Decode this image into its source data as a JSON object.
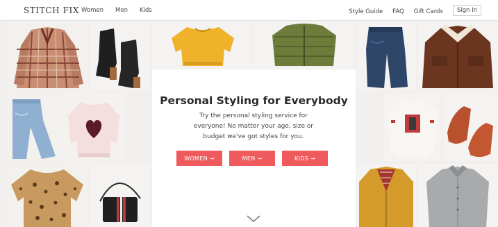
{
  "header": {
    "logo": "STITCH FIX",
    "nav_left": [
      "Women",
      "Men",
      "Kids"
    ],
    "nav_right": [
      "Style Guide",
      "FAQ",
      "Gift Cards"
    ],
    "sign_in": "Sign In"
  },
  "hero": {
    "title": "Personal Styling for Everybody",
    "subtitle": "Try the personal styling service for everyone! No matter your age, size or budget we've got styles for you.",
    "buttons": [
      "WOMEN →",
      "MEN →",
      "KIDS →"
    ],
    "accent_color": "#ef5a5d"
  },
  "tiles": [
    "plaid-coat",
    "black-boots",
    "yellow-sweater",
    "green-puffer-jacket",
    "dark-jeans",
    "brown-corduroy-jacket",
    "light-jeans",
    "heart-sweater",
    "graphic-tee",
    "brown-sneakers",
    "leopard-blouse",
    "black-crossbody-bag",
    "mustard-jacket",
    "grey-shirt"
  ]
}
